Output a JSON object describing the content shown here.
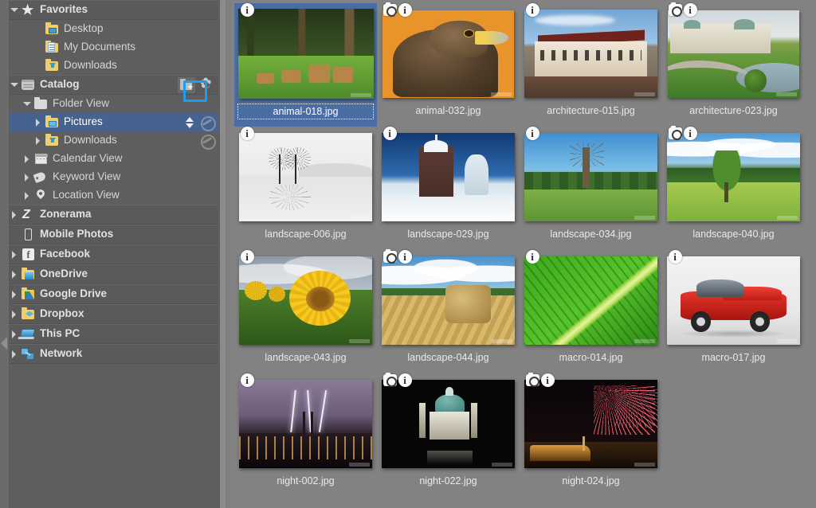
{
  "app": {
    "accent_blue": "#1e9cf0",
    "selection_blue": "#46628f",
    "sidebar_bg": "#5e5e5e",
    "content_bg": "#828282"
  },
  "sidebar": {
    "items": [
      {
        "label": "Favorites",
        "icon": "star-icon",
        "level": 0,
        "twisty": "down",
        "type": "section"
      },
      {
        "label": "Desktop",
        "icon": "folder-desktop-icon",
        "level": 2,
        "twisty": "none",
        "type": "child"
      },
      {
        "label": "My Documents",
        "icon": "folder-documents-icon",
        "level": 2,
        "twisty": "none",
        "type": "child"
      },
      {
        "label": "Downloads",
        "icon": "folder-downloads-icon",
        "level": 2,
        "twisty": "none",
        "type": "child"
      },
      {
        "label": "Catalog",
        "icon": "catalog-icon",
        "level": 0,
        "twisty": "down",
        "type": "section"
      },
      {
        "label": "Folder View",
        "icon": "folder-plain-icon",
        "level": 1,
        "twisty": "down",
        "type": "child"
      },
      {
        "label": "Pictures",
        "icon": "folder-pictures-icon",
        "level": 2,
        "twisty": "right",
        "type": "child",
        "selected": true
      },
      {
        "label": "Downloads",
        "icon": "folder-downloads-icon",
        "level": 2,
        "twisty": "right",
        "type": "child"
      },
      {
        "label": "Calendar View",
        "icon": "calendar-icon",
        "level": 1,
        "twisty": "right",
        "type": "child"
      },
      {
        "label": "Keyword View",
        "icon": "tag-icon",
        "level": 1,
        "twisty": "right",
        "type": "child"
      },
      {
        "label": "Location View",
        "icon": "pin-icon",
        "level": 1,
        "twisty": "right",
        "type": "child"
      },
      {
        "label": "Zonerama",
        "icon": "zonerama-icon",
        "level": 0,
        "twisty": "right",
        "type": "section"
      },
      {
        "label": "Mobile Photos",
        "icon": "phone-icon",
        "level": 0,
        "twisty": "none",
        "type": "section"
      },
      {
        "label": "Facebook",
        "icon": "facebook-icon",
        "level": 0,
        "twisty": "right",
        "type": "section"
      },
      {
        "label": "OneDrive",
        "icon": "onedrive-icon",
        "level": 0,
        "twisty": "right",
        "type": "section"
      },
      {
        "label": "Google Drive",
        "icon": "google-drive-icon",
        "level": 0,
        "twisty": "right",
        "type": "section"
      },
      {
        "label": "Dropbox",
        "icon": "dropbox-icon",
        "level": 0,
        "twisty": "right",
        "type": "section"
      },
      {
        "label": "This PC",
        "icon": "this-pc-icon",
        "level": 0,
        "twisty": "right",
        "type": "section"
      },
      {
        "label": "Network",
        "icon": "network-icon",
        "level": 0,
        "twisty": "right",
        "type": "section"
      }
    ],
    "catalog_add_folder_icon": "add-folder-icon",
    "catalog_settings_icon": "gear-icon",
    "pictures_sort_icon": "sort-updown-icon",
    "pictures_sync_icon": "sync-icon",
    "downloads_sync_icon": "sync-icon",
    "collapse_handle_icon": "collapse-left-icon",
    "highlighted_button": "add-folder-icon"
  },
  "thumbnails": [
    {
      "name": "animal-018.jpg",
      "art": "p-deer",
      "selected": true,
      "badges": [
        "info-icon"
      ]
    },
    {
      "name": "animal-032.jpg",
      "art": "p-eagle",
      "selected": false,
      "badges": [
        "camera-icon",
        "info-icon"
      ]
    },
    {
      "name": "architecture-015.jpg",
      "art": "p-arch1",
      "selected": false,
      "badges": [
        "info-icon"
      ]
    },
    {
      "name": "architecture-023.jpg",
      "art": "p-arch2",
      "selected": false,
      "badges": [
        "camera-icon",
        "info-icon"
      ]
    },
    {
      "name": "landscape-006.jpg",
      "art": "p-bw",
      "selected": false,
      "badges": [
        "info-icon"
      ]
    },
    {
      "name": "landscape-029.jpg",
      "art": "p-snow",
      "selected": false,
      "badges": [
        "info-icon"
      ]
    },
    {
      "name": "landscape-034.jpg",
      "art": "p-field",
      "selected": false,
      "badges": [
        "info-icon"
      ]
    },
    {
      "name": "landscape-040.jpg",
      "art": "p-meadow",
      "selected": false,
      "badges": [
        "camera-icon",
        "info-icon"
      ]
    },
    {
      "name": "landscape-043.jpg",
      "art": "p-sun",
      "selected": false,
      "badges": [
        "info-icon"
      ]
    },
    {
      "name": "landscape-044.jpg",
      "art": "p-hay",
      "selected": false,
      "badges": [
        "camera-icon",
        "info-icon"
      ]
    },
    {
      "name": "macro-014.jpg",
      "art": "p-leaf",
      "selected": false,
      "badges": [
        "info-icon"
      ]
    },
    {
      "name": "macro-017.jpg",
      "art": "p-car",
      "selected": false,
      "badges": [
        "info-icon"
      ]
    },
    {
      "name": "night-002.jpg",
      "art": "p-light",
      "selected": false,
      "badges": [
        "info-icon"
      ]
    },
    {
      "name": "night-022.jpg",
      "art": "p-church",
      "selected": false,
      "badges": [
        "camera-icon",
        "info-icon"
      ]
    },
    {
      "name": "night-024.jpg",
      "art": "p-fire",
      "selected": false,
      "badges": [
        "camera-icon",
        "info-icon"
      ]
    }
  ]
}
